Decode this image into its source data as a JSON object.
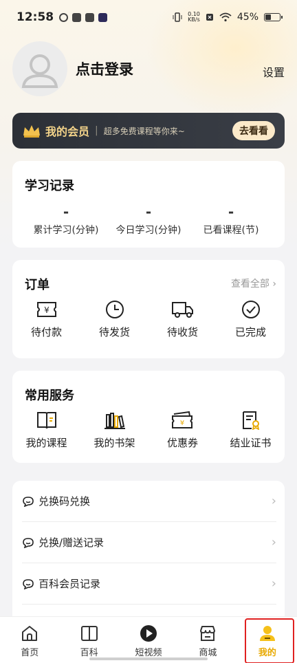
{
  "status_bar": {
    "time": "12:58",
    "net_speed_value": "0.10",
    "net_speed_unit": "KB/s",
    "battery": "45%"
  },
  "profile": {
    "login_label": "点击登录",
    "settings_label": "设置"
  },
  "vip": {
    "title": "我的会员",
    "subtitle": "超多免费课程等你来~",
    "button": "去看看"
  },
  "study": {
    "title": "学习记录",
    "stats": [
      {
        "value": "-",
        "label": "累计学习(分钟)"
      },
      {
        "value": "-",
        "label": "今日学习(分钟)"
      },
      {
        "value": "-",
        "label": "已看课程(节)"
      }
    ]
  },
  "orders": {
    "title": "订单",
    "view_all": "查看全部",
    "items": [
      {
        "label": "待付款",
        "icon": "ticket-yen-icon"
      },
      {
        "label": "待发货",
        "icon": "clock-icon"
      },
      {
        "label": "待收货",
        "icon": "truck-icon"
      },
      {
        "label": "已完成",
        "icon": "check-circle-icon"
      }
    ]
  },
  "services": {
    "title": "常用服务",
    "items": [
      {
        "label": "我的课程",
        "icon": "book-icon"
      },
      {
        "label": "我的书架",
        "icon": "bookshelf-icon"
      },
      {
        "label": "优惠券",
        "icon": "coupon-icon"
      },
      {
        "label": "结业证书",
        "icon": "certificate-icon"
      }
    ]
  },
  "list": {
    "items": [
      {
        "label": "兑换码兑换",
        "icon": "chat-bubble-icon"
      },
      {
        "label": "兑换/赠送记录",
        "icon": "chat-bubble-icon"
      },
      {
        "label": "百科会员记录",
        "icon": "chat-bubble-icon"
      }
    ]
  },
  "tabbar": {
    "tabs": [
      {
        "label": "首页",
        "icon": "home-icon"
      },
      {
        "label": "百科",
        "icon": "book-open-icon"
      },
      {
        "label": "短视频",
        "icon": "play-circle-icon"
      },
      {
        "label": "商城",
        "icon": "shop-icon"
      },
      {
        "label": "我的",
        "icon": "user-icon"
      }
    ],
    "active_index": 4
  },
  "colors": {
    "accent": "#e8a900",
    "vip_gold": "#f4d48a",
    "highlight_border": "#e02020"
  }
}
